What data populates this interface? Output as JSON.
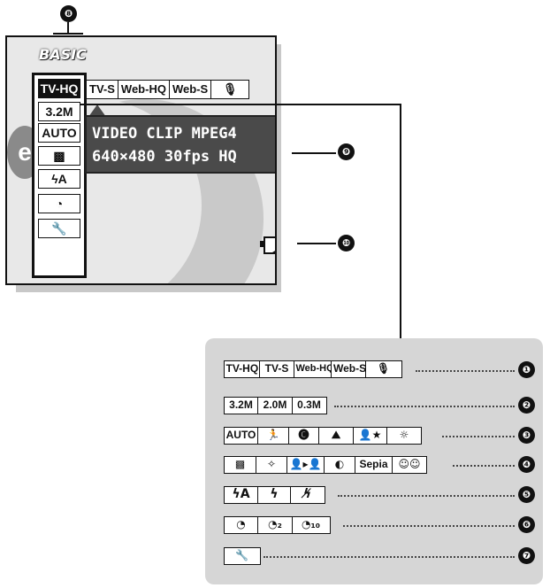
{
  "callouts": {
    "c8": "❽",
    "c9": "❾",
    "c10": "❿",
    "c1": "❶",
    "c2": "❷",
    "c3": "❸",
    "c4": "❹",
    "c5": "❺",
    "c6": "❻",
    "c7": "❼"
  },
  "screen": {
    "mode_label": "BASIC",
    "bg_letter": "e",
    "left_column": [
      "TV-HQ",
      "3.2M",
      "AUTO",
      "▩",
      "ϟA",
      "◔",
      "🔧"
    ],
    "top_row": [
      "TV-S",
      "Web-HQ",
      "Web-S",
      "🎙"
    ],
    "info_line1": "VIDEO CLIP MPEG4",
    "info_line2": "640×480 30fps HQ"
  },
  "panel": {
    "row1": [
      "TV-HQ",
      "TV-S",
      "Web-HQ",
      "Web-S",
      "🎙"
    ],
    "row2": [
      "3.2M",
      "2.0M",
      "0.3M"
    ],
    "row3": [
      "AUTO",
      "🏃",
      "🅒",
      "⛰",
      "👤★",
      "☼"
    ],
    "row4": [
      "▩",
      "✧",
      "👤▸👤",
      "◐",
      "Sepia",
      "☺☺"
    ],
    "row5": [
      "ϟA",
      "ϟ",
      "ϟ̸"
    ],
    "row6": [
      "◔",
      "◔₂",
      "◔₁₀"
    ],
    "row7": [
      "🔧"
    ]
  },
  "icons": {
    "battery": "battery-low-icon"
  }
}
